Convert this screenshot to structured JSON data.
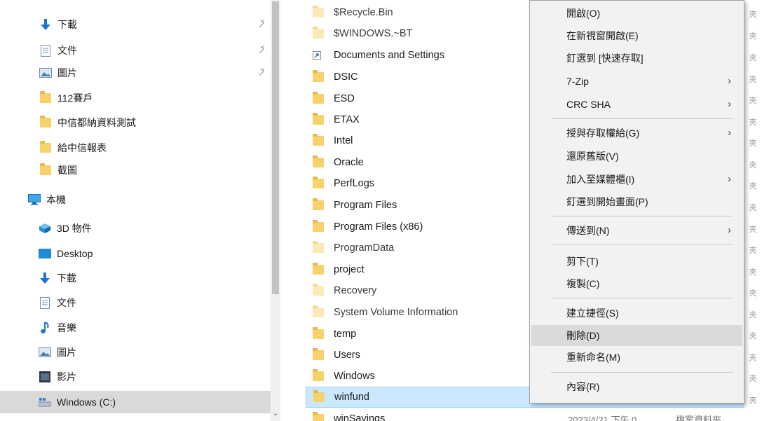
{
  "nav_pane": {
    "quick_access": [
      {
        "label": "下載",
        "icon": "download-arrow-icon",
        "pinned": true
      },
      {
        "label": "文件",
        "icon": "document-icon",
        "pinned": true
      },
      {
        "label": "圖片",
        "icon": "pictures-icon",
        "pinned": true
      },
      {
        "label": "112賽戶",
        "icon": "folder-icon",
        "pinned": false
      },
      {
        "label": "中信都納資料測試",
        "icon": "folder-icon",
        "pinned": false
      },
      {
        "label": "給中信報表",
        "icon": "folder-icon",
        "pinned": false
      },
      {
        "label": "截圖",
        "icon": "folder-icon",
        "pinned": false
      }
    ],
    "this_pc": {
      "label": "本機",
      "icon": "computer-icon"
    },
    "this_pc_items": [
      {
        "label": "3D 物件",
        "icon": "3d-objects-icon"
      },
      {
        "label": "Desktop",
        "icon": "desktop-icon"
      },
      {
        "label": "下載",
        "icon": "download-arrow-icon"
      },
      {
        "label": "文件",
        "icon": "document-icon"
      },
      {
        "label": "音樂",
        "icon": "music-note-icon"
      },
      {
        "label": "圖片",
        "icon": "pictures-icon"
      },
      {
        "label": "影片",
        "icon": "video-icon"
      },
      {
        "label": "Windows (C:)",
        "icon": "drive-icon",
        "selected": true
      }
    ],
    "partial_next_label": ""
  },
  "file_list": {
    "rows": [
      {
        "name": "$Recycle.Bin",
        "icon": "folder-icon",
        "faded": true
      },
      {
        "name": "$WINDOWS.~BT",
        "icon": "folder-icon",
        "faded": true
      },
      {
        "name": "Documents and Settings",
        "icon": "shortcut-icon",
        "faded": false
      },
      {
        "name": "DSIC",
        "icon": "folder-icon",
        "faded": false
      },
      {
        "name": "ESD",
        "icon": "folder-icon",
        "faded": false
      },
      {
        "name": "ETAX",
        "icon": "folder-icon",
        "faded": false
      },
      {
        "name": "Intel",
        "icon": "folder-icon",
        "faded": false
      },
      {
        "name": "Oracle",
        "icon": "folder-icon",
        "faded": false
      },
      {
        "name": "PerfLogs",
        "icon": "folder-icon",
        "faded": false
      },
      {
        "name": "Program Files",
        "icon": "folder-icon",
        "faded": false
      },
      {
        "name": "Program Files (x86)",
        "icon": "folder-icon",
        "faded": false
      },
      {
        "name": "ProgramData",
        "icon": "folder-icon",
        "faded": true
      },
      {
        "name": "project",
        "icon": "folder-icon",
        "faded": false
      },
      {
        "name": "Recovery",
        "icon": "folder-icon",
        "faded": true
      },
      {
        "name": "System Volume Information",
        "icon": "folder-icon",
        "faded": true
      },
      {
        "name": "temp",
        "icon": "folder-icon",
        "faded": false
      },
      {
        "name": "Users",
        "icon": "folder-icon",
        "faded": false
      },
      {
        "name": "Windows",
        "icon": "folder-icon",
        "faded": false
      },
      {
        "name": "winfund",
        "icon": "folder-icon",
        "faded": false,
        "selected": true
      },
      {
        "name": "winSavings",
        "icon": "folder-icon",
        "faded": false,
        "date": "2023/4/21 下午 0...",
        "type": "檔案資料夾"
      }
    ],
    "type_column_glyph": "夾"
  },
  "context_menu": {
    "items": [
      {
        "label": "開啟(O)",
        "submenu": false
      },
      {
        "label": "在新視窗開啟(E)",
        "submenu": false
      },
      {
        "label": "釘選到 [快速存取]",
        "submenu": false
      },
      {
        "label": "7-Zip",
        "submenu": true
      },
      {
        "label": "CRC SHA",
        "submenu": true
      },
      {
        "label": "授與存取權給(G)",
        "submenu": true
      },
      {
        "label": "還原舊版(V)",
        "submenu": false
      },
      {
        "label": "加入至媒體櫃(I)",
        "submenu": true
      },
      {
        "label": "釘選到開始畫面(P)",
        "submenu": false
      },
      {
        "label": "傳送到(N)",
        "submenu": true
      },
      {
        "label": "剪下(T)",
        "submenu": false
      },
      {
        "label": "複製(C)",
        "submenu": false
      },
      {
        "label": "建立捷徑(S)",
        "submenu": false
      },
      {
        "label": "刪除(D)",
        "submenu": false,
        "hovered": true
      },
      {
        "label": "重新命名(M)",
        "submenu": false
      },
      {
        "label": "內容(R)",
        "submenu": false
      }
    ],
    "submenu_arrow": "›"
  },
  "colors": {
    "selection_bg": "#cce8ff",
    "selection_border": "#99d1ff",
    "menu_bg": "#f2f2f2",
    "menu_hover": "#dadada",
    "folder": "#f7d26a",
    "nav_selected": "#d9d9d9"
  }
}
